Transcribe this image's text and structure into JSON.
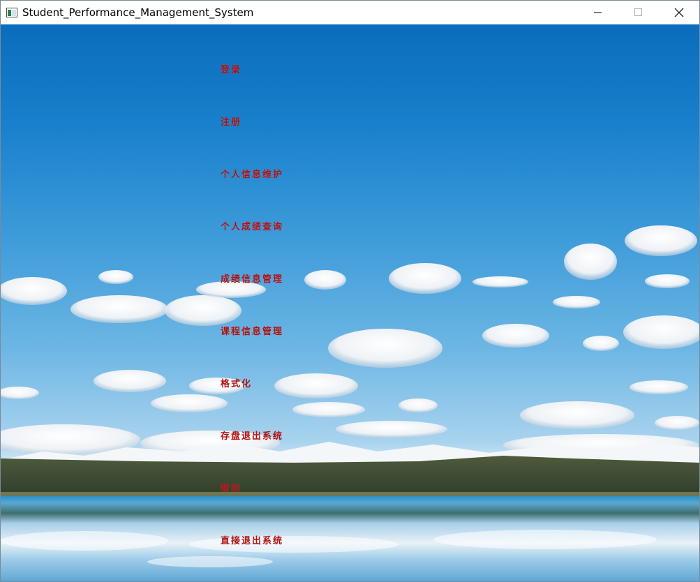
{
  "window": {
    "title": "Student_Performance_Management_System",
    "icons": {
      "app": "app-window-icon",
      "minimize": "minimize-icon",
      "maximize": "maximize-icon",
      "close": "close-icon"
    }
  },
  "menu": {
    "items": [
      {
        "label": "登录"
      },
      {
        "label": "注册"
      },
      {
        "label": "个人信息维护"
      },
      {
        "label": "个人成绩查询"
      },
      {
        "label": "成绩信息管理"
      },
      {
        "label": "课程信息管理"
      },
      {
        "label": "格式化"
      },
      {
        "label": "存盘退出系统"
      },
      {
        "label": "帮助"
      },
      {
        "label": "直接退出系统"
      }
    ],
    "text_color": "#b01010"
  },
  "background": {
    "subject": "sky-clouds-mountains-lake"
  }
}
